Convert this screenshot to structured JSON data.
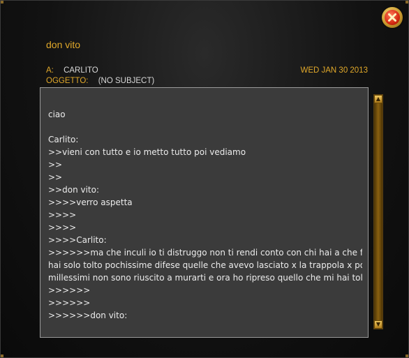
{
  "window": {
    "close_icon": "close-icon",
    "accent_color": "#e0a82a"
  },
  "header": {
    "sender": "don vito",
    "to_label": "A:",
    "to_value": "CARLITO",
    "subject_label": "OGGETTO:",
    "subject_value": "(NO SUBJECT)",
    "date": "WED JAN 30 2013"
  },
  "message": {
    "lines": [
      "ciao",
      "",
      "Carlito:",
      ">>vieni con tutto e io metto tutto poi vediamo",
      ">>",
      ">>",
      ">>don vito:",
      ">>>>verro aspetta",
      ">>>>",
      ">>>>",
      ">>>>Carlito:",
      ">>>>>>ma che inculi io ti distruggo non ti rendi conto con chi hai a che fare",
      "hai solo tolto pochissime difese quelle che avevo lasciato x la trappola x pochi",
      "millessimi non sono riuscito a murarti e ora ho ripreso quello che mi hai tolto",
      ">>>>>>",
      ">>>>>>",
      ">>>>>>don vito:"
    ]
  },
  "scrollbar": {
    "up_icon": "scroll-up-arrow-icon",
    "down_icon": "scroll-down-arrow-icon"
  }
}
